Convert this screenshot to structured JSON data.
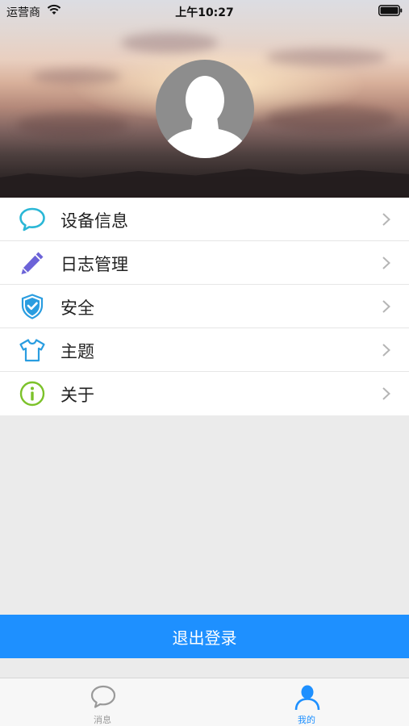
{
  "status_bar": {
    "carrier": "运营商",
    "time": "上午10:27",
    "wifi_icon": "wifi-icon",
    "battery_icon": "battery-icon"
  },
  "profile": {
    "avatar_icon": "default-avatar-icon"
  },
  "menu": {
    "items": [
      {
        "label": "设备信息",
        "icon": "speech-bubble-icon",
        "color": "#2ab7d6"
      },
      {
        "label": "日志管理",
        "icon": "pencil-icon",
        "color": "#6c63d8"
      },
      {
        "label": "安全",
        "icon": "shield-check-icon",
        "color": "#2a9de0"
      },
      {
        "label": "主题",
        "icon": "tshirt-icon",
        "color": "#2a9de0"
      },
      {
        "label": "关于",
        "icon": "info-icon",
        "color": "#7cc22a"
      }
    ]
  },
  "logout": {
    "label": "退出登录",
    "color": "#1e90ff"
  },
  "tab_bar": {
    "tabs": [
      {
        "label": "消息",
        "icon": "speech-bubble-icon",
        "active": false
      },
      {
        "label": "我的",
        "icon": "person-icon",
        "active": true
      }
    ]
  }
}
